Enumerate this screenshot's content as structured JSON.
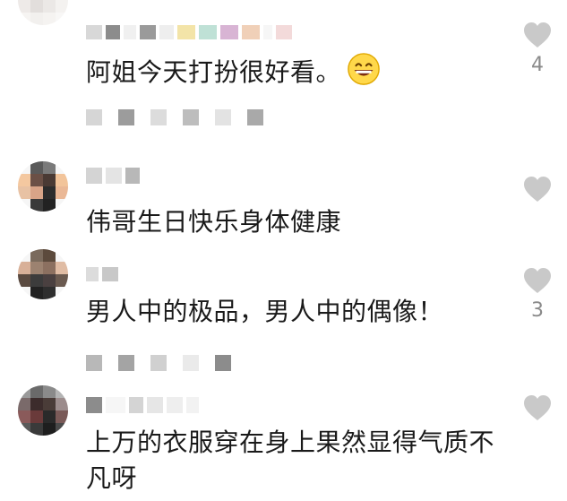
{
  "comments": [
    {
      "text": "阿姐今天打扮很好看。",
      "emoji": "grinning-face-emoji",
      "likes": "4"
    },
    {
      "text": "伟哥生日快乐身体健康",
      "likes": ""
    },
    {
      "text": "男人中的极品，男人中的偶像！",
      "likes": "3"
    },
    {
      "text": "上万的衣服穿在身上果然显得气质不凡呀",
      "likes": ""
    }
  ],
  "icons": {
    "like": "heart-icon"
  },
  "colors": {
    "heart": "#c9c9c9",
    "text": "#1a1a1a",
    "count": "#8a8a8a",
    "blur_block": "#9a9a9a"
  }
}
